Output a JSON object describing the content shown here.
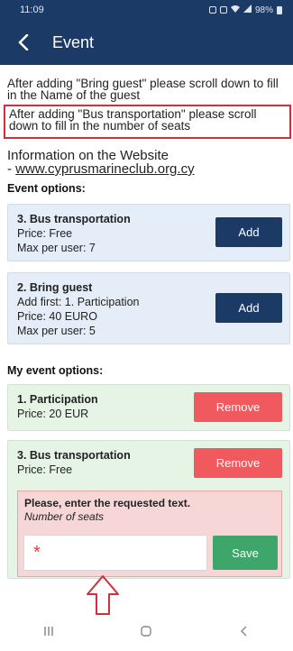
{
  "status": {
    "time": "11:09",
    "battery": "98%"
  },
  "header": {
    "title": "Event"
  },
  "notices": {
    "bring_guest": "After adding \"Bring guest\" please scroll down to fill in the Name of the guest",
    "bus_transport": "After adding \"Bus transportation\" please scroll down to fill in the number of seats"
  },
  "info": {
    "line1": "Information on the Website",
    "prefix": "- ",
    "link": "www.cyprusmarineclub.org.cy"
  },
  "event_options": {
    "label": "Event options:",
    "items": [
      {
        "title": "3. Bus transportation",
        "price": "Price: Free",
        "max": "Max per user: 7",
        "button": "Add"
      },
      {
        "title": "2. Bring guest",
        "add_first": "Add first: 1. Participation",
        "price": "Price: 40 EURO",
        "max": "Max per user: 5",
        "button": "Add"
      }
    ]
  },
  "my_event_options": {
    "label": "My event options:",
    "items": [
      {
        "title": "1. Participation",
        "price": "Price: 20 EUR",
        "button": "Remove"
      },
      {
        "title": "3. Bus transportation",
        "price": "Price: Free",
        "button": "Remove",
        "prompt": {
          "title": "Please, enter the requested text.",
          "subtitle": "Number of seats",
          "required_mark": "*",
          "value": "",
          "save": "Save"
        }
      }
    ]
  },
  "colors": {
    "primary": "#1b3a66",
    "remove": "#f05a5f",
    "save": "#3ea56b",
    "highlight_border": "#d32f3a"
  },
  "icons": {
    "back": "back-arrow-icon",
    "annotation": "arrow-up-outline-icon",
    "nav": [
      "recent-apps-icon",
      "home-icon",
      "back-icon"
    ]
  }
}
